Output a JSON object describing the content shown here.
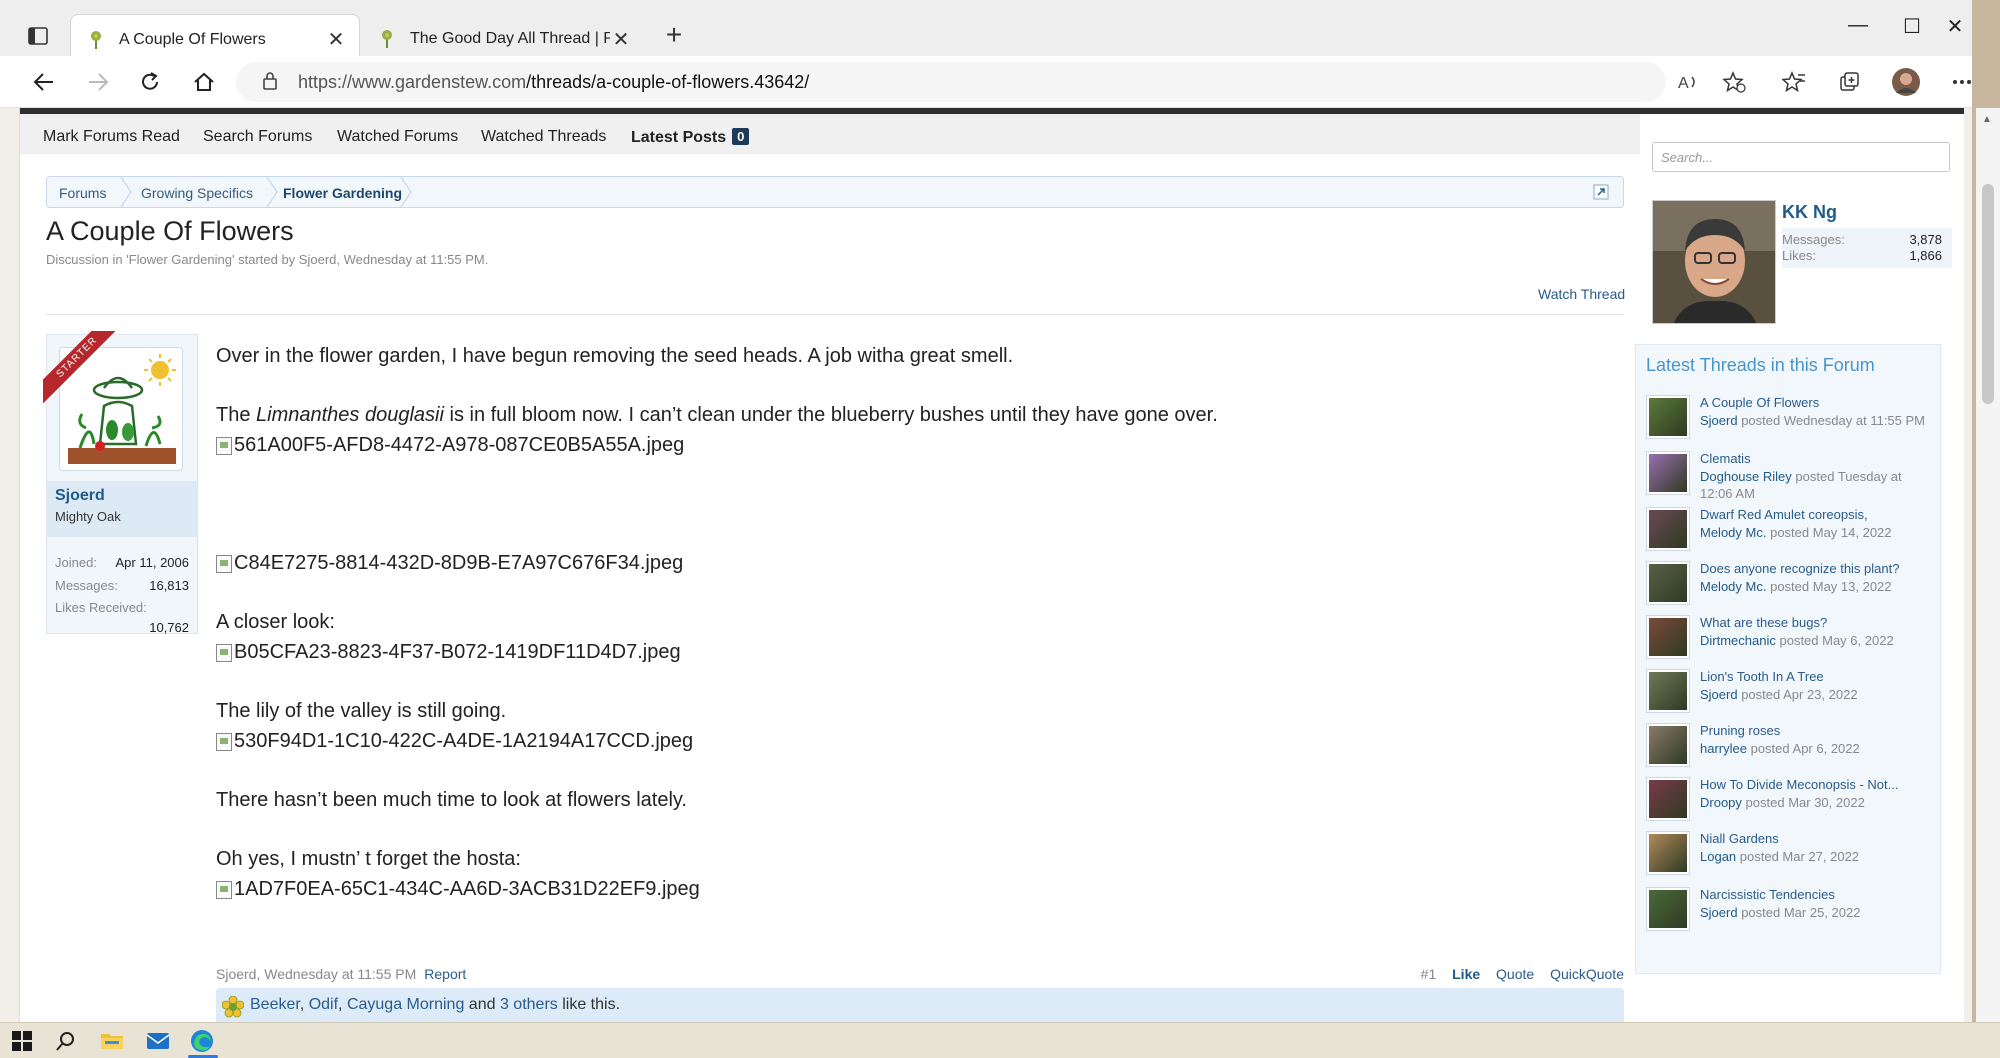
{
  "browser": {
    "tabs": [
      {
        "title": "A Couple Of Flowers",
        "active": true
      },
      {
        "title": "The Good Day All Thread | Page",
        "active": false
      }
    ],
    "new_tab": "+",
    "url_host": "https://www.gardenstew.com",
    "url_path": "/threads/a-couple-of-flowers.43642/",
    "window_controls": {
      "minimize": "—",
      "maximize": "☐",
      "close": "✕"
    }
  },
  "subnav": {
    "items": [
      "Mark Forums Read",
      "Search Forums",
      "Watched Forums",
      "Watched Threads"
    ],
    "latest_posts": "Latest Posts",
    "latest_count": "0"
  },
  "breadcrumb": [
    "Forums",
    "Growing Specifics",
    "Flower Gardening"
  ],
  "thread": {
    "title": "A Couple Of Flowers",
    "meta": "Discussion in 'Flower Gardening' started by Sjoerd, Wednesday at 11:55 PM.",
    "watch": "Watch Thread"
  },
  "author": {
    "badge": "STARTER",
    "name": "Sjoerd",
    "title": "Mighty Oak",
    "joined_label": "Joined:",
    "joined": "Apr 11, 2006",
    "messages_label": "Messages:",
    "messages": "16,813",
    "likes_label": "Likes Received:",
    "likes": "10,762"
  },
  "post": {
    "line1": "Over in the flower garden, I have begun removing the seed heads. A job witha great smell.",
    "line2_pre": "The ",
    "line2_em": "Limnanthes douglasii",
    "line2_post": " is in full bloom now. I can’t clean under the blueberry bushes until they have gone over.",
    "img1": "561A00F5-AFD8-4472-A978-087CE0B5A55A.jpeg",
    "img2": "C84E7275-8814-432D-8D9B-E7A97C676F34.jpeg",
    "line3": "A closer look:",
    "img3": "B05CFA23-8823-4F37-B072-1419DF11D4D7.jpeg",
    "line4": "The lily of the valley is still going.",
    "img4": "530F94D1-1C10-422C-A4DE-1A2194A17CCD.jpeg",
    "line5": "There hasn’t been much time to look at flowers lately.",
    "line6": "Oh yes, I mustn’ t forget the hosta:",
    "img5": "1AD7F0EA-65C1-434C-AA6D-3ACB31D22EF9.jpeg",
    "footer_author": "Sjoerd, Wednesday at 11:55 PM",
    "report": "Report",
    "number": "#1",
    "like": "Like",
    "quote": "Quote",
    "quickquote": "QuickQuote",
    "likers": [
      "Beeker",
      "Odif",
      "Cayuga Morning"
    ],
    "likes_and": "and",
    "likes_others": "3 others",
    "likes_suffix": "like this."
  },
  "sidebar": {
    "search_placeholder": "Search...",
    "visitor": {
      "name": "KK Ng",
      "messages_label": "Messages:",
      "messages": "3,878",
      "likes_label": "Likes:",
      "likes": "1,866"
    },
    "latest_title": "Latest Threads in this Forum",
    "threads": [
      {
        "title": "A Couple Of Flowers",
        "user": "Sjoerd",
        "posted": "posted Wednesday at 11:55 PM",
        "color": "#5c7a3a"
      },
      {
        "title": "Clematis",
        "user": "Doghouse Riley",
        "posted": "posted Tuesday at 12:06 AM",
        "color": "#9a6fb0"
      },
      {
        "title": "Dwarf Red Amulet coreopsis,",
        "user": "Melody Mc.",
        "posted": "posted May 14, 2022",
        "color": "#6a4a55"
      },
      {
        "title": "Does anyone recognize this plant?",
        "user": "Melody Mc.",
        "posted": "posted May 13, 2022",
        "color": "#5a6048"
      },
      {
        "title": "What are these bugs?",
        "user": "Dirtmechanic",
        "posted": "posted May 6, 2022",
        "color": "#7a4a3a"
      },
      {
        "title": "Lion's Tooth In A Tree",
        "user": "Sjoerd",
        "posted": "posted Apr 23, 2022",
        "color": "#6f7a5a"
      },
      {
        "title": "Pruning roses",
        "user": "harrylee",
        "posted": "posted Apr 6, 2022",
        "color": "#8a7a6a"
      },
      {
        "title": "How To Divide Meconopsis - Not...",
        "user": "Droopy",
        "posted": "posted Mar 30, 2022",
        "color": "#7a3a4a"
      },
      {
        "title": "Niall Gardens",
        "user": "Logan",
        "posted": "posted Mar 27, 2022",
        "color": "#b08a5a"
      },
      {
        "title": "Narcissistic Tendencies",
        "user": "Sjoerd",
        "posted": "posted Mar 25, 2022",
        "color": "#4a6a3a"
      }
    ]
  }
}
